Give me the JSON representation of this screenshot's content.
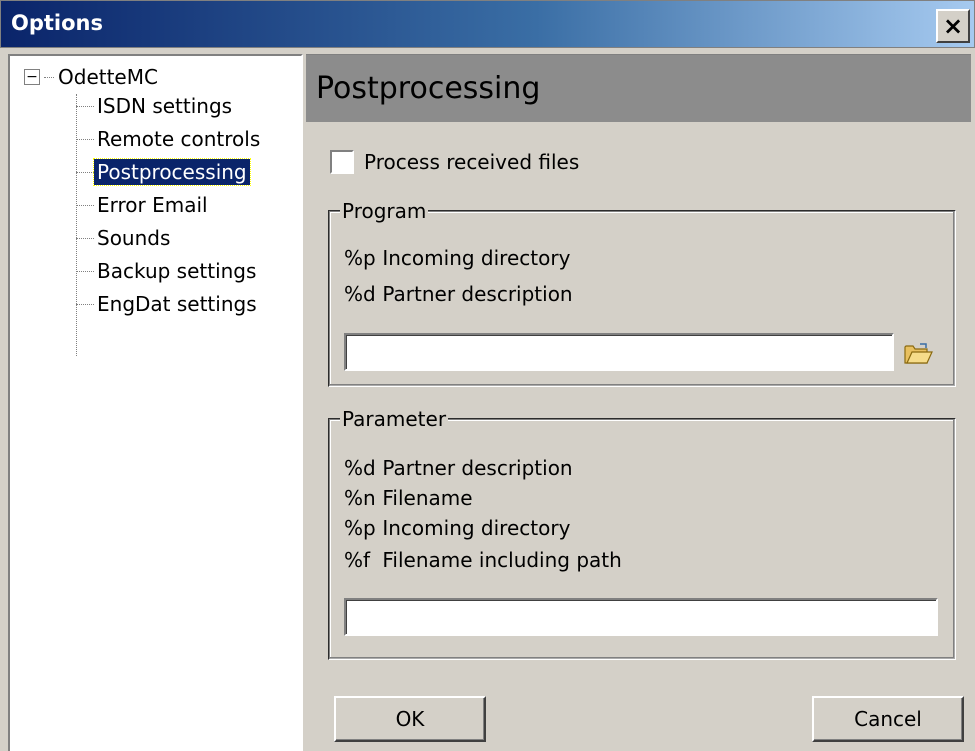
{
  "window": {
    "title": "Options",
    "close_glyph": "×"
  },
  "tree": {
    "root": {
      "label": "OdetteMC",
      "expander": "−"
    },
    "items": [
      {
        "label": "ISDN settings"
      },
      {
        "label": "Remote controls"
      },
      {
        "label": "Postprocessing",
        "selected": true
      },
      {
        "label": "Error Email"
      },
      {
        "label": "Sounds"
      },
      {
        "label": "Backup settings"
      },
      {
        "label": "EngDat settings"
      }
    ]
  },
  "panel": {
    "title": "Postprocessing",
    "process_checkbox": {
      "label": "Process received files",
      "checked": false
    },
    "program_group": {
      "legend": "Program",
      "hints": [
        {
          "code": "%p",
          "desc": "Incoming directory"
        },
        {
          "code": "%d",
          "desc": "Partner description"
        }
      ],
      "value": "",
      "browse_icon": "folder-open-icon"
    },
    "parameter_group": {
      "legend": "Parameter",
      "hints": [
        {
          "code": "%d",
          "desc": "Partner description"
        },
        {
          "code": "%n",
          "desc": "Filename"
        },
        {
          "code": "%p",
          "desc": "Incoming directory"
        },
        {
          "code": "%f",
          "desc": "Filename including path"
        }
      ],
      "value": ""
    },
    "buttons": {
      "ok": "OK",
      "cancel": "Cancel"
    }
  },
  "colors": {
    "titlebar_start": "#0a246a",
    "titlebar_end": "#a6caf0",
    "selection": "#0a246a",
    "face": "#d4d0c8",
    "header": "#8c8c8c"
  }
}
